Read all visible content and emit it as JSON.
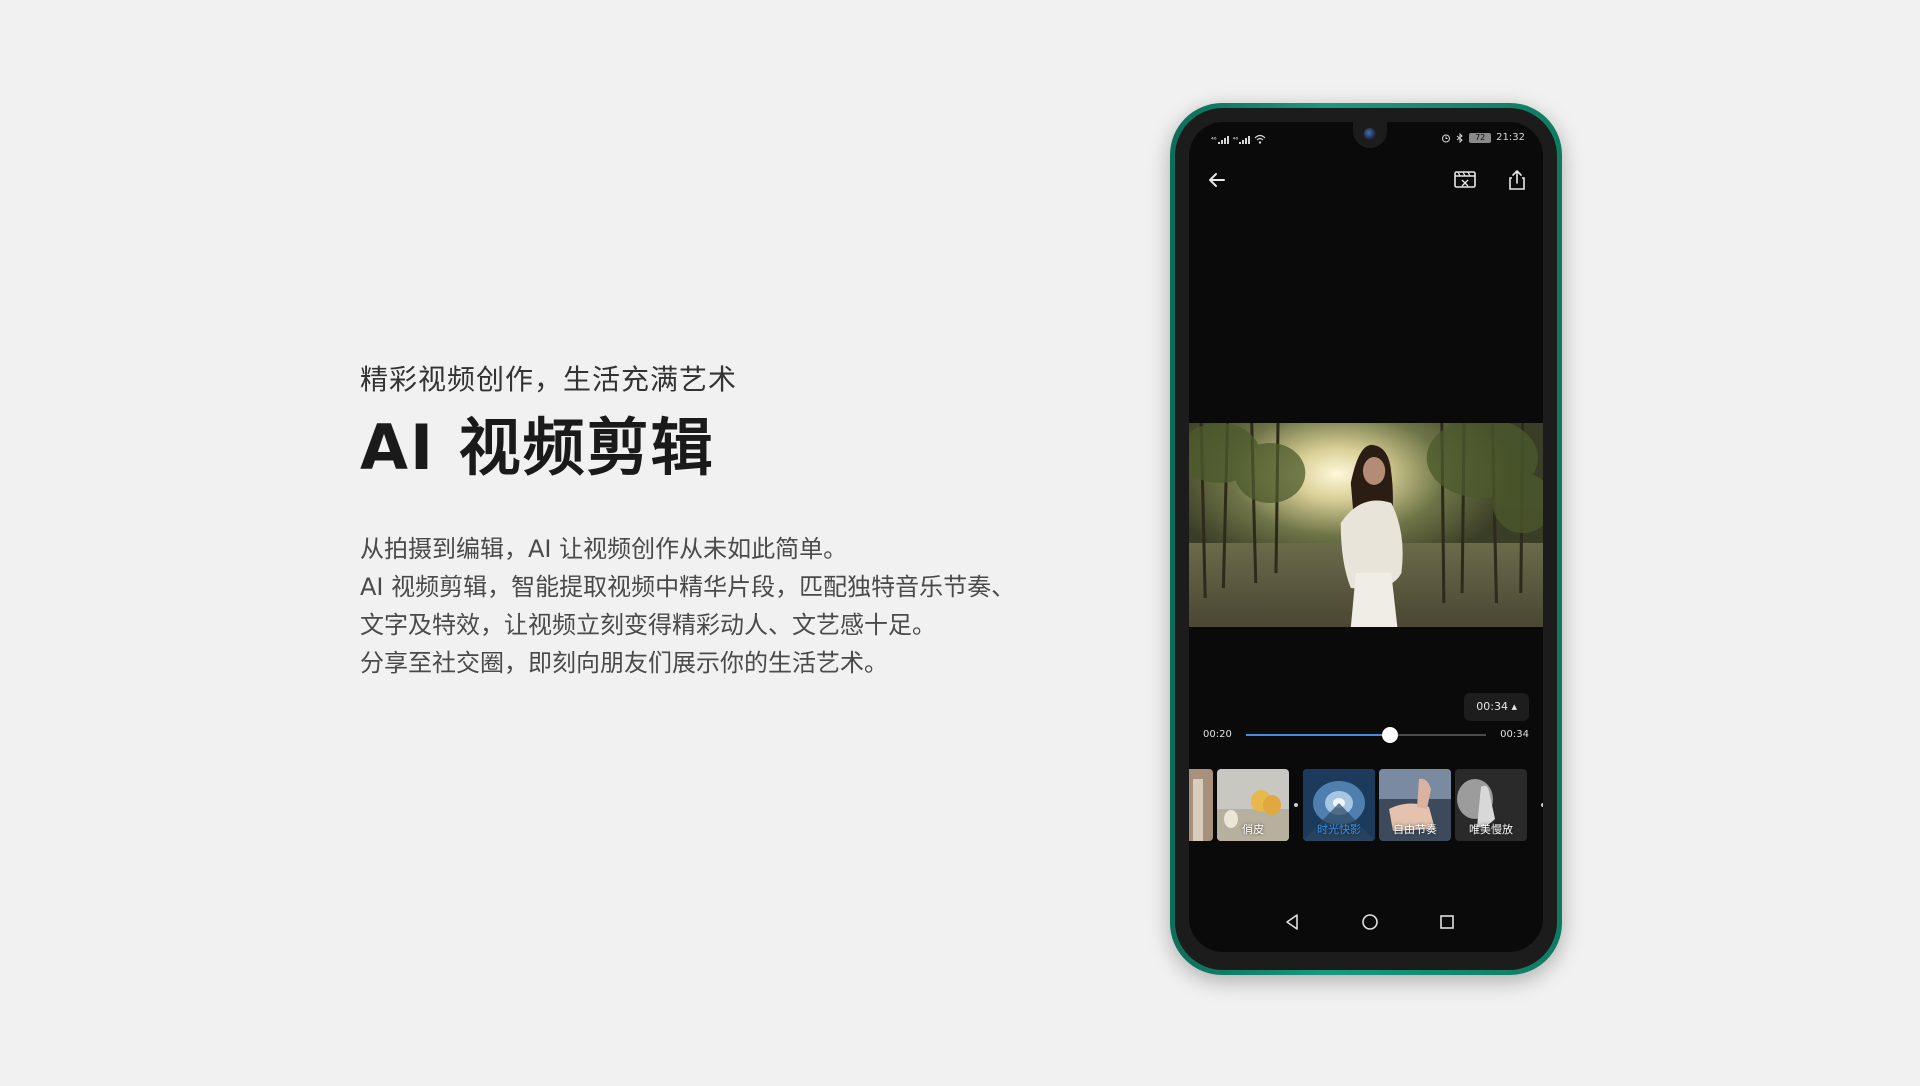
{
  "promo": {
    "subtitle": "精彩视频创作，生活充满艺术",
    "title": "AI 视频剪辑",
    "description": [
      "从拍摄到编辑，AI 让视频创作从未如此简单。",
      "AI 视频剪辑，智能提取视频中精华片段，匹配独特音乐节奏、",
      "文字及特效，让视频立刻变得精彩动人、文艺感十足。",
      "分享至社交圈，即刻向朋友们展示你的生活艺术。"
    ]
  },
  "phone": {
    "frame_color": "#1a9a7d",
    "status_bar": {
      "signal_1": "⁴⁶",
      "signal_2": "⁴⁶",
      "battery": "72",
      "time": "21:32",
      "icons": [
        "signal-icon",
        "signal-icon",
        "wifi-icon",
        "alarm-icon",
        "bluetooth-icon",
        "battery-icon"
      ]
    },
    "toolbar": {
      "icons": [
        "back-arrow-icon",
        "export-video-icon",
        "share-icon"
      ]
    },
    "player": {
      "duration_badge": "00:34 ▴",
      "start_time": "00:20",
      "end_time": "00:34",
      "progress": 0.6,
      "accent": "#3b8fde"
    },
    "templates": [
      {
        "label": "",
        "icon": "partial-thumbnail"
      },
      {
        "label": "俏皮",
        "icon": "chicks-thumbnail"
      },
      {
        "label": "时光快影",
        "icon": "tunnel-thumbnail",
        "selected": true
      },
      {
        "label": "自由节奏",
        "icon": "hands-thumbnail"
      },
      {
        "label": "唯美慢放",
        "icon": "dancer-thumbnail"
      }
    ],
    "nav": {
      "icons": [
        "back-triangle-icon",
        "home-circle-icon",
        "recents-square-icon"
      ]
    }
  }
}
